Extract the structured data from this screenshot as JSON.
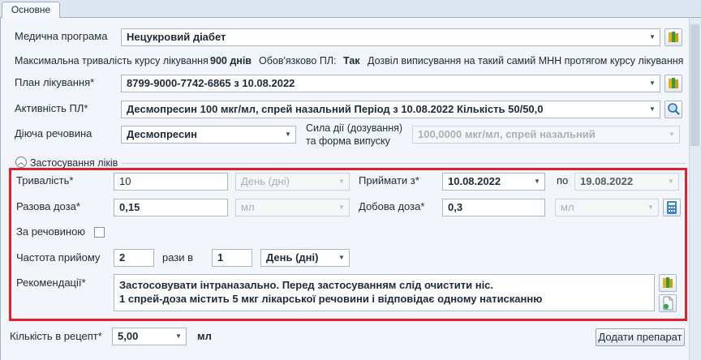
{
  "tabs": [
    {
      "label": "Основне"
    }
  ],
  "program": {
    "label": "Медична програма",
    "value": "Нецукровий діабет"
  },
  "info": {
    "max_duration_label": "Максимальна тривалість курсу лікування",
    "max_duration_value": "900 днів",
    "mandatory_label": "Обов'язково ПЛ:",
    "mandatory_value": "Так",
    "allow_text": "Дозвіл виписування на такий самий МНН протягом курсу лікування"
  },
  "plan": {
    "label": "План лікування*",
    "value": "8799-9000-7742-6865 з 10.08.2022"
  },
  "activity": {
    "label": "Активність ПЛ*",
    "value": "Десмопресин 100 мкг/мл, спрей назальний Період з 10.08.2022 Кількість 50/50,0"
  },
  "substance": {
    "label": "Діюча речовина",
    "value": "Десмопресин",
    "strength_label_1": "Сила дії (дозування)",
    "strength_label_2": "та форма випуску",
    "strength_value": "100,0000 мкг/мл, спрей назальний"
  },
  "section": {
    "title": "Застосування ліків"
  },
  "duration": {
    "label": "Тривалість*",
    "value": "10",
    "unit": "День (дні)"
  },
  "take_from": {
    "label": "Приймати з*",
    "value": "10.08.2022",
    "to_label": "по",
    "to_value": "19.08.2022"
  },
  "single_dose": {
    "label": "Разова доза*",
    "value": "0,15",
    "unit": "мл"
  },
  "daily_dose": {
    "label": "Добова доза*",
    "value": "0,3",
    "unit": "мл"
  },
  "by_substance": {
    "label": "За речовиною"
  },
  "frequency": {
    "label": "Частота прийому",
    "times": "2",
    "times_label": "рази в",
    "period_value": "1",
    "period_unit": "День (дні)"
  },
  "recommendations": {
    "label": "Рекомендації*",
    "line1": "Застосовувати інтраназально. Перед застосуванням слід очистити ніс.",
    "line2": "1 спрей-доза містить 5 мкг лікарської речовини і відповідає одному натисканню"
  },
  "quantity": {
    "label": "Кількість в рецепт*",
    "value": "5,00",
    "unit": "мл"
  },
  "add_button": {
    "label": "Додати препарат"
  },
  "colors": {
    "highlight": "#e0202a",
    "panel": "#f2f5f9"
  }
}
